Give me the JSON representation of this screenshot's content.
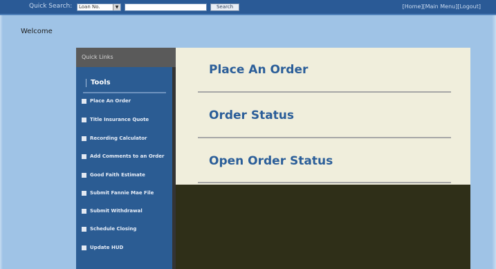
{
  "header": {
    "quick_search_label": "Quick Search:",
    "quick_search_select_value": "Loan No.",
    "quick_search_select_arrow": "▼",
    "quick_search_input_value": "",
    "search_button_label": "Search",
    "links": [
      "[Home]",
      "[Main Menu]",
      "[Logout]"
    ]
  },
  "welcome": "Welcome",
  "quick_links": {
    "header": "Quick Links",
    "section_title": "Tools",
    "items": [
      "Place An Order",
      "Title Insurance Quote",
      "Recording Calculator",
      "Add Comments to an Order",
      "Good Faith Estimate",
      "Submit Fannie Mae File",
      "Submit Withdrawal",
      "Schedule Closing",
      "Update HUD"
    ]
  },
  "main_links": [
    "Place An Order",
    "Order Status",
    "Open Order Status"
  ],
  "colors": {
    "page_bg": "#9fc3e6",
    "topbar": "#2a5a96",
    "sidebar": "#2b5c93",
    "main_panel": "#f0eedc",
    "link_text": "#2b5e99",
    "dark_panel": "#2f2f18"
  }
}
